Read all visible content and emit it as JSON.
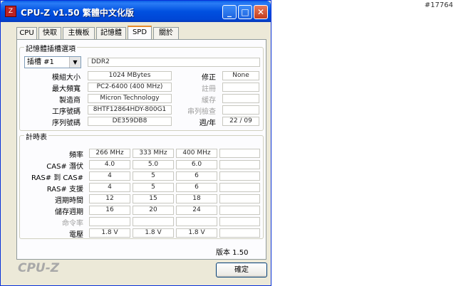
{
  "watermark": "#17764",
  "window": {
    "title": "CPU-Z v1.50 繁體中文化版",
    "icon_text": "Z",
    "buttons": {
      "minimize": "_",
      "maximize": "□",
      "close": "✕"
    }
  },
  "tabs": [
    {
      "label": "CPU",
      "active": false
    },
    {
      "label": "快取",
      "active": false
    },
    {
      "label": "主機板",
      "active": false
    },
    {
      "label": "記憶體",
      "active": false
    },
    {
      "label": "SPD",
      "active": true
    },
    {
      "label": "關於",
      "active": false
    }
  ],
  "slot_group": {
    "title": "記憶體插槽選項",
    "slot_select": "插槽 #1",
    "memory_type": "DDR2",
    "labels": {
      "module_size": "模組大小",
      "max_bandwidth": "最大頻寬",
      "manufacturer": "製造商",
      "part_number": "工序號碼",
      "serial_number": "序列號碼",
      "correction": "修正",
      "registered": "註冊",
      "buffered": "緩存",
      "spd_ext": "串列檢查",
      "week_year": "週/年"
    },
    "values": {
      "module_size": "1024 MBytes",
      "max_bandwidth": "PC2-6400 (400 MHz)",
      "manufacturer": "Micron Technology",
      "part_number": "8HTF12864HDY-800G1",
      "serial_number": "DE359DB8",
      "correction": "None",
      "registered": "",
      "buffered": "",
      "spd_ext": "",
      "week_year": "22 / 09"
    }
  },
  "timings_group": {
    "title": "計時表",
    "row_labels": [
      "頻率",
      "CAS# 潛伏",
      "RAS# 到 CAS#",
      "RAS# 支援",
      "週期時間",
      "儲存週期",
      "命令率",
      "電壓"
    ],
    "columns": [
      [
        "266 MHz",
        "4.0",
        "4",
        "4",
        "12",
        "16",
        "",
        "1.8 V"
      ],
      [
        "333 MHz",
        "5.0",
        "5",
        "5",
        "15",
        "20",
        "",
        "1.8 V"
      ],
      [
        "400 MHz",
        "6.0",
        "6",
        "6",
        "18",
        "24",
        "",
        "1.8 V"
      ],
      [
        "",
        "",
        "",
        "",
        "",
        "",
        "",
        ""
      ]
    ]
  },
  "footer": {
    "version": "版本 1.50",
    "brand": "CPU-Z",
    "ok_label": "確定"
  }
}
